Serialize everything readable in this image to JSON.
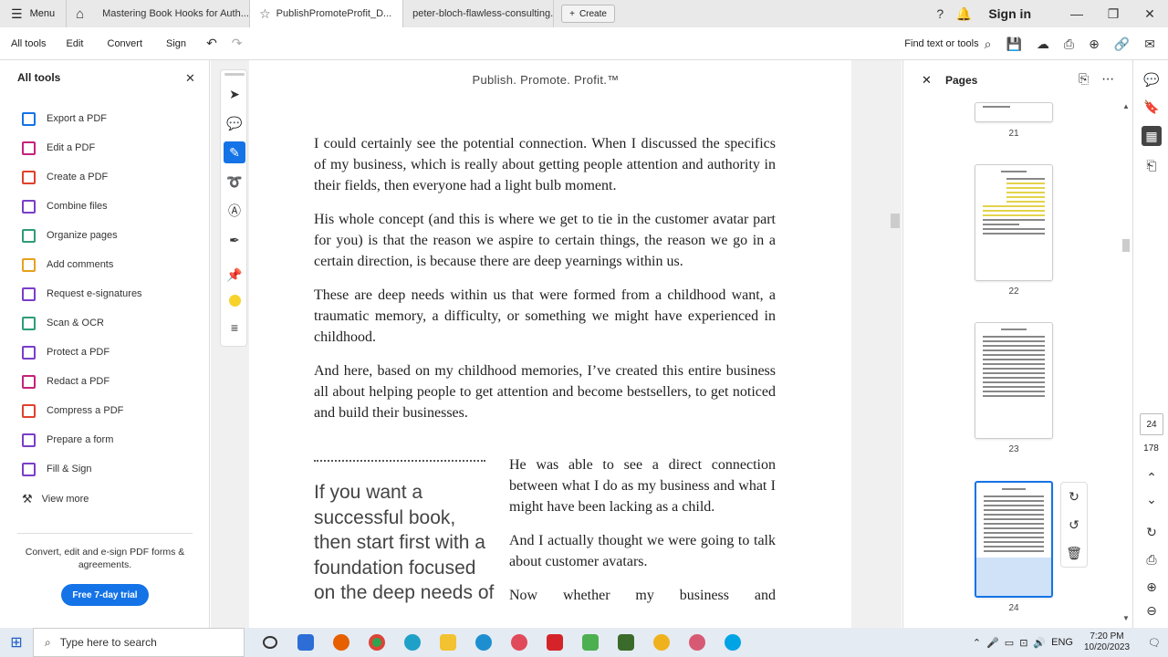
{
  "titlebar": {
    "menu_label": "Menu",
    "tabs": [
      {
        "label": "Mastering Book Hooks for Auth..."
      },
      {
        "label": "PublishPromoteProfit_D..."
      },
      {
        "label": "peter-bloch-flawless-consulting..."
      }
    ],
    "create_label": "Create",
    "signin_label": "Sign in"
  },
  "toolbar": {
    "items": [
      "All tools",
      "Edit",
      "Convert",
      "Sign"
    ],
    "find_label": "Find text or tools"
  },
  "left_panel": {
    "title": "All tools",
    "tools": [
      {
        "label": "Export a PDF",
        "color": "#1473e6"
      },
      {
        "label": "Edit a PDF",
        "color": "#c5227a"
      },
      {
        "label": "Create a PDF",
        "color": "#e0412b"
      },
      {
        "label": "Combine files",
        "color": "#7a3ec8"
      },
      {
        "label": "Organize pages",
        "color": "#2d9d78"
      },
      {
        "label": "Add comments",
        "color": "#e6a11e"
      },
      {
        "label": "Request e-signatures",
        "color": "#7a3ec8"
      },
      {
        "label": "Scan & OCR",
        "color": "#2d9d78"
      },
      {
        "label": "Protect a PDF",
        "color": "#7a3ec8"
      },
      {
        "label": "Redact a PDF",
        "color": "#c5227a"
      },
      {
        "label": "Compress a PDF",
        "color": "#e0412b"
      },
      {
        "label": "Prepare a form",
        "color": "#7a3ec8"
      },
      {
        "label": "Fill & Sign",
        "color": "#7a3ec8"
      }
    ],
    "view_more": "View more",
    "promo_text": "Convert, edit and e-sign PDF forms & agreements.",
    "trial_button": "Free 7-day trial"
  },
  "document": {
    "running_head": "Publish. Promote. Profit.™",
    "paragraphs": [
      "I could certainly see the potential connection. When I discussed the specifics of my business, which is really about getting people attention and authority in their fields, then everyone had a light bulb moment.",
      "His whole concept (and this is where we get to tie in the customer avatar part for you) is that the reason we aspire to certain things, the reason we go in a certain direction, is because there are deep yearnings within us.",
      "These are deep needs within us that were formed from a childhood want, a traumatic memory, a difficulty, or something we might have experienced in childhood.",
      "And here, based on my childhood memories, I’ve created this entire business all about helping people to get attention and become bestsellers, to get noticed and build their businesses."
    ],
    "pull_quote": "If you want a successful book, then start first with a foundation focused on the deep needs of",
    "col2_paragraphs": [
      "He was able to see a direct connection between what I do as my business and what I might have been lacking as a child.",
      "And I actually thought we were going to talk about customer avatars.",
      "Now whether my business and"
    ]
  },
  "pages_panel": {
    "title": "Pages",
    "pages": [
      "21",
      "22",
      "23",
      "24"
    ]
  },
  "right_rail": {
    "current_page": "24",
    "total_pages": "178"
  },
  "taskbar": {
    "search_placeholder": "Type here to search",
    "lang": "ENG",
    "time": "7:20 PM",
    "date": "10/20/2023"
  }
}
